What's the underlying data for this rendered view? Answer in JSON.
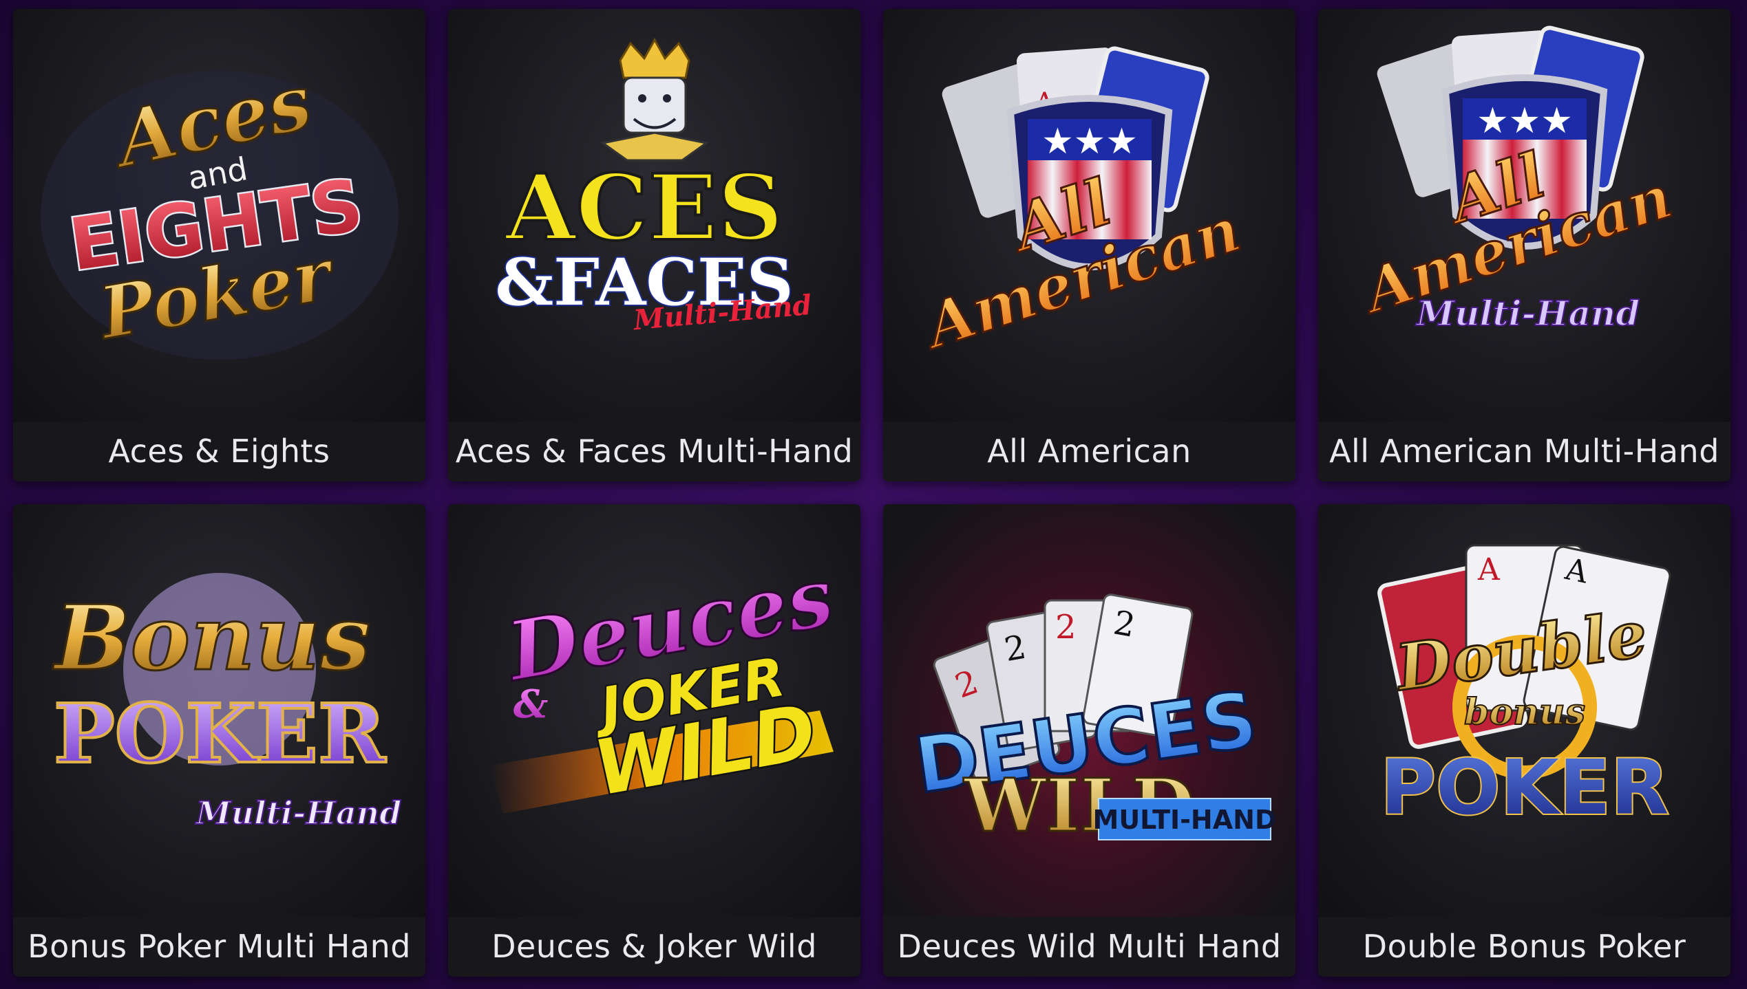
{
  "games": [
    {
      "title": "Aces & Eights",
      "logo": {
        "line1": "Aces",
        "line2": "and",
        "line3": "EIGHTS",
        "line4": "Poker"
      }
    },
    {
      "title": "Aces & Faces Multi-Hand",
      "logo": {
        "line1": "ACES",
        "line2": "&FACES",
        "line3": "Multi-Hand"
      }
    },
    {
      "title": "All American",
      "logo": {
        "line1": "All",
        "line2": "American"
      }
    },
    {
      "title": "All American Multi-Hand",
      "logo": {
        "line1": "All",
        "line2": "American",
        "line3": "Multi-Hand"
      }
    },
    {
      "title": "Bonus Poker Multi Hand",
      "logo": {
        "line1": "Bonus",
        "line2": "POKER",
        "line3": "Multi-Hand"
      }
    },
    {
      "title": "Deuces & Joker Wild",
      "logo": {
        "line1": "Deuces",
        "line2": "&",
        "line3": "JOKER",
        "line4": "WILD"
      }
    },
    {
      "title": "Deuces Wild Multi Hand",
      "logo": {
        "line1": "DEUCES",
        "line2": "WILD",
        "line3": "MULTI-HAND"
      }
    },
    {
      "title": "Double Bonus Poker",
      "logo": {
        "line1": "Double",
        "line2": "bonus",
        "line3": "POKER"
      }
    }
  ],
  "colors": {
    "page_bg": "#2a0a4c",
    "tile_bg": "#151517",
    "caption_text": "#e9e9ee",
    "gold": "#e8b64a",
    "red": "#d81f3a",
    "blue": "#2a3fbf",
    "purple": "#8a4fe0",
    "magenta": "#d63ad6",
    "yellow": "#f3e21a"
  }
}
